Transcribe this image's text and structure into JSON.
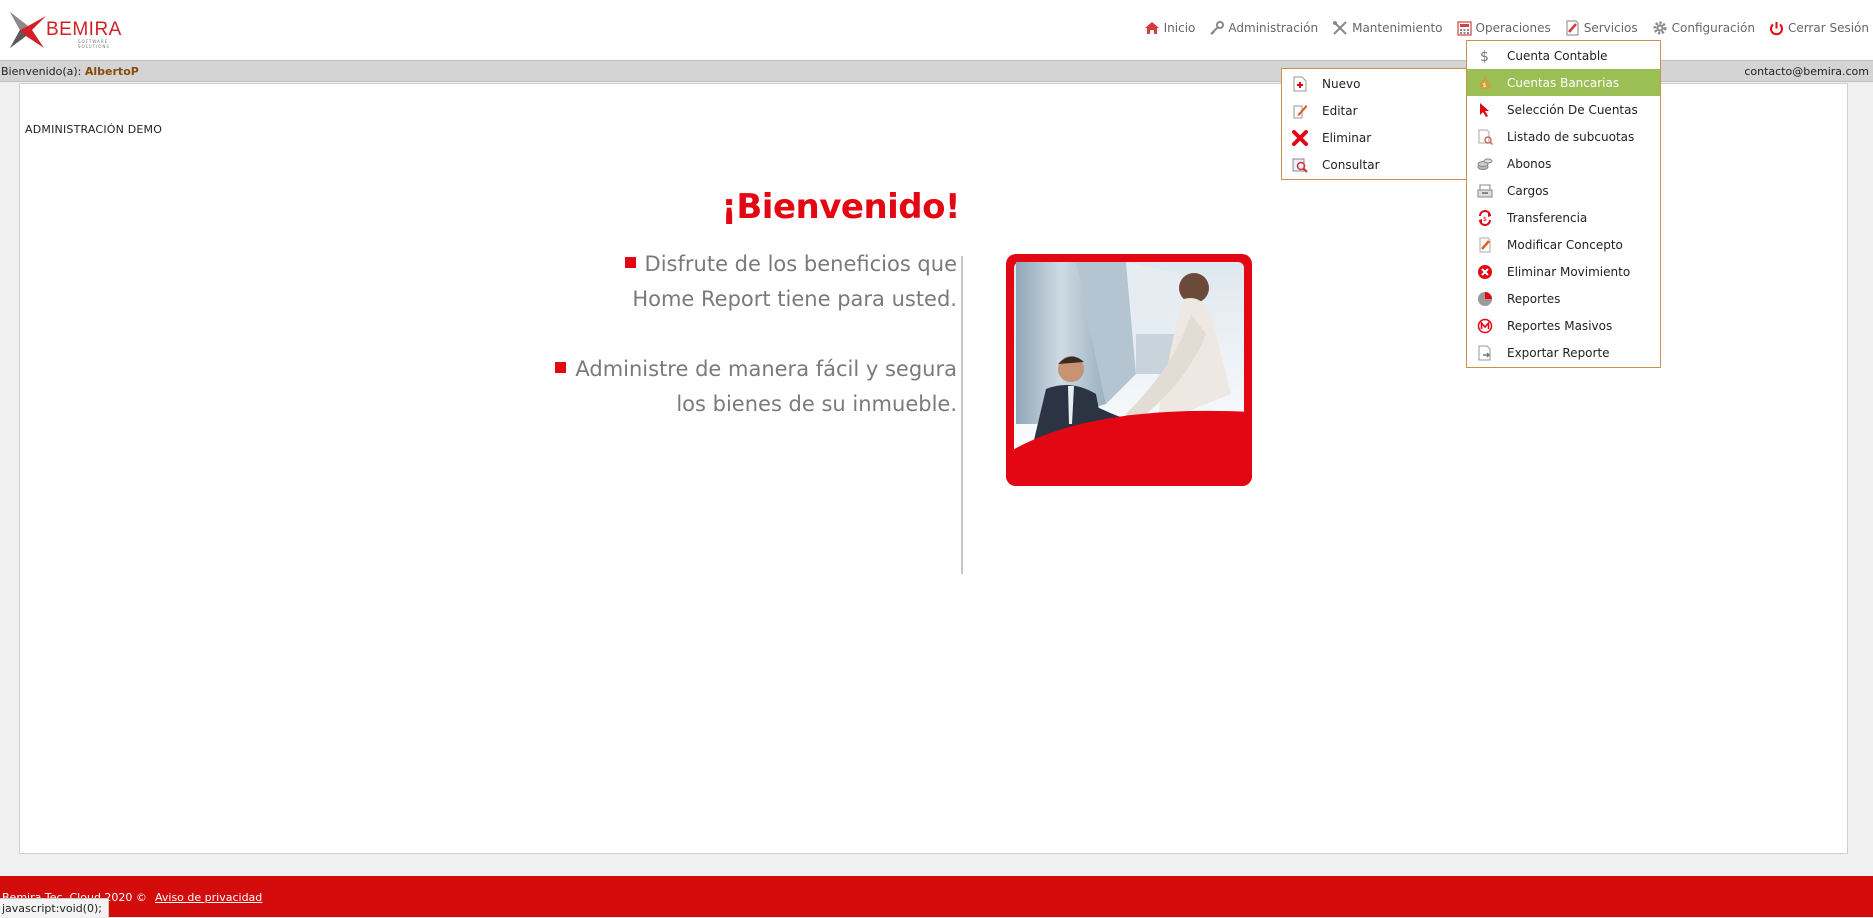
{
  "brand": {
    "name": "BEMIRA",
    "tagline": "SOFTWARE SOLUTIONS",
    "color": "#d32027"
  },
  "nav": [
    {
      "label": "Inicio",
      "icon": "home-icon"
    },
    {
      "label": "Administración",
      "icon": "key-icon"
    },
    {
      "label": "Mantenimiento",
      "icon": "tools-icon"
    },
    {
      "label": "Operaciones",
      "icon": "calculator-icon"
    },
    {
      "label": "Servicios",
      "icon": "invoice-icon"
    },
    {
      "label": "Configuración",
      "icon": "gear-icon"
    },
    {
      "label": "Cerrar Sesión",
      "icon": "power-icon"
    }
  ],
  "userbar": {
    "welcome_label": "Bienvenido(a):",
    "username": "AlbertoP",
    "email": "contacto@bemira.com"
  },
  "main": {
    "admin_label": "ADMINISTRACIÓN DEMO",
    "welcome_title": "¡Bienvenido!",
    "bullet1_line1": "Disfrute de los beneficios que",
    "bullet1_line2": "Home Report tiene para usted.",
    "bullet2_line1": "Administre de manera fácil y segura",
    "bullet2_line2": "los bienes de su inmueble."
  },
  "services_menu": {
    "items": [
      {
        "label": "Cuenta Contable",
        "icon": "dollar-icon"
      },
      {
        "label": "Cuentas Bancarias",
        "icon": "money-bag-icon",
        "active": true
      },
      {
        "label": "Selección De Cuentas",
        "icon": "cursor-icon"
      },
      {
        "label": "Listado de subcuotas",
        "icon": "list-search-icon"
      },
      {
        "label": "Abonos",
        "icon": "coins-icon"
      },
      {
        "label": "Cargos",
        "icon": "cash-register-icon"
      },
      {
        "label": "Transferencia",
        "icon": "transfer-icon"
      },
      {
        "label": "Modificar Concepto",
        "icon": "edit-document-icon"
      },
      {
        "label": "Eliminar Movimiento",
        "icon": "delete-circle-icon"
      },
      {
        "label": "Reportes",
        "icon": "pie-chart-icon"
      },
      {
        "label": "Reportes Masivos",
        "icon": "m-circle-icon"
      },
      {
        "label": "Exportar Reporte",
        "icon": "export-document-icon"
      }
    ]
  },
  "submenu": {
    "items": [
      {
        "label": "Nuevo",
        "icon": "new-document-icon"
      },
      {
        "label": "Editar",
        "icon": "edit-icon"
      },
      {
        "label": "Eliminar",
        "icon": "delete-x-icon"
      },
      {
        "label": "Consultar",
        "icon": "search-document-icon"
      }
    ]
  },
  "footer": {
    "copyright": "Bemira Tec. Cloud 2020 ©",
    "privacy_link": "Aviso de privacidad"
  },
  "statusbar": {
    "text": "javascript:void(0);"
  },
  "colors": {
    "accent": "#e30613",
    "menu_active": "#9cbf55",
    "menu_border": "#c9914e",
    "footer": "#d40b0b"
  }
}
